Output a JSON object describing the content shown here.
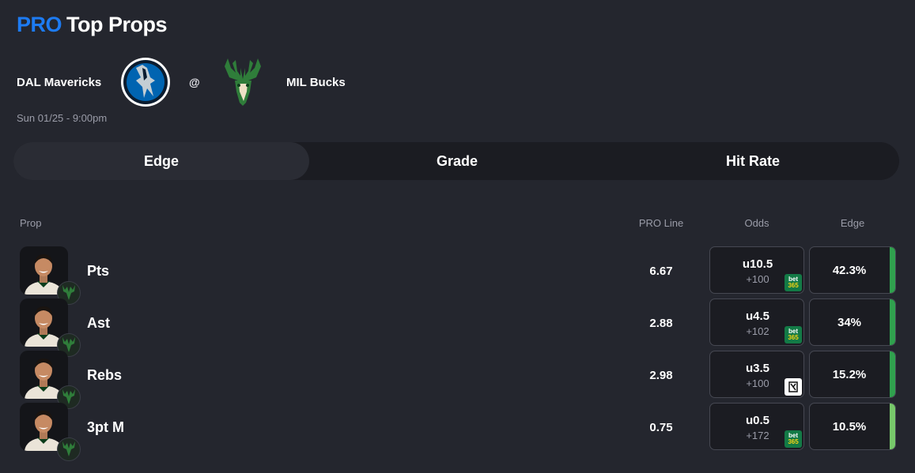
{
  "header": {
    "brand": "PRO",
    "title": "Top Props"
  },
  "game": {
    "away_team": "DAL Mavericks",
    "separator": "@",
    "home_team": "MIL Bucks",
    "datetime": "Sun 01/25 - 9:00pm"
  },
  "tabs": [
    {
      "label": "Edge",
      "active": true
    },
    {
      "label": "Grade",
      "active": false
    },
    {
      "label": "Hit Rate",
      "active": false
    }
  ],
  "columns": {
    "prop": "Prop",
    "pro_line": "PRO Line",
    "odds": "Odds",
    "edge": "Edge"
  },
  "colors": {
    "brand": "#1d7bf2",
    "edge_strong": "#30a14e",
    "edge_light": "#77c86a",
    "bucks_green": "#00471b"
  },
  "rows": [
    {
      "prop": "Pts",
      "pro_line": "6.67",
      "odds_line": "u10.5",
      "odds_price": "+100",
      "book": "bet365",
      "book_icon": "bet365-icon",
      "edge": "42.3%",
      "edge_pct": 42.3
    },
    {
      "prop": "Ast",
      "pro_line": "2.88",
      "odds_line": "u4.5",
      "odds_price": "+102",
      "book": "bet365",
      "book_icon": "bet365-icon",
      "edge": "34%",
      "edge_pct": 34
    },
    {
      "prop": "Rebs",
      "pro_line": "2.98",
      "odds_line": "u3.5",
      "odds_price": "+100",
      "book": "other",
      "book_icon": "sportsbook-icon",
      "edge": "15.2%",
      "edge_pct": 15.2
    },
    {
      "prop": "3pt M",
      "pro_line": "0.75",
      "odds_line": "u0.5",
      "odds_price": "+172",
      "book": "bet365",
      "book_icon": "bet365-icon",
      "edge": "10.5%",
      "edge_pct": 10.5
    }
  ]
}
